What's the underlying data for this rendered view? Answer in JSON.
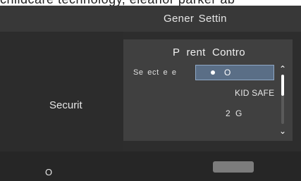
{
  "banner": {
    "text": "childcare technology, eleanor parker ab"
  },
  "header": {
    "title": "Gener  Settin"
  },
  "sidebar": {
    "section_label": "Securit"
  },
  "dialog": {
    "title": "P rent  Contro",
    "row_label": "Se ect e e",
    "selected_option": "O",
    "options": [
      "KID SAFE",
      "2 G"
    ]
  },
  "footer": {
    "left_label": "O"
  },
  "colors": {
    "background": "#2d2d2d",
    "dialog_bg": "#404040",
    "selection_fill": "#5a6e86",
    "selection_border": "#8fa8c6"
  },
  "icons": {
    "scroll_up": "chevron-up-icon",
    "scroll_down": "chevron-down-icon",
    "radio": "radio-dot-icon"
  }
}
